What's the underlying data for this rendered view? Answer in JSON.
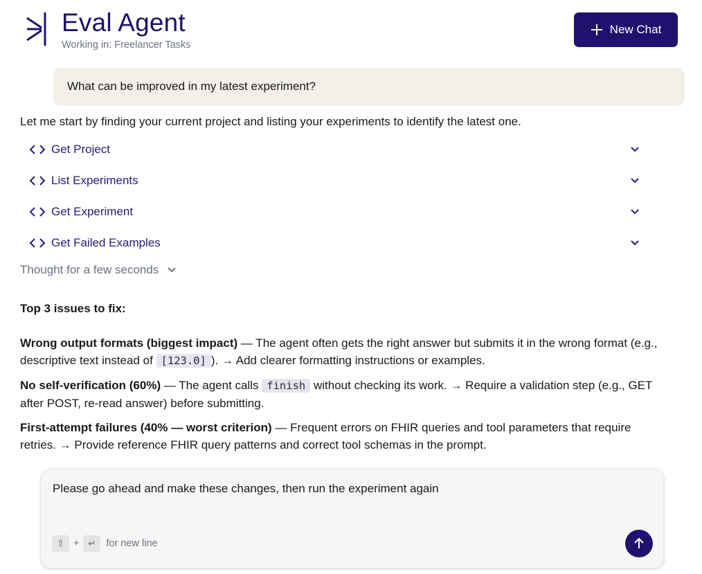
{
  "header": {
    "logo_icon": "asterisk-bar-logo",
    "title": "Eval Agent",
    "subtitle": "Working in: Freelancer Tasks",
    "new_chat_label": "New Chat",
    "accent_color": "#22106e"
  },
  "user_message": "What can be improved in my latest experiment?",
  "assistant": {
    "intro": "Let me start by finding your current project and listing your experiments to identify the latest one.",
    "tool_calls": [
      {
        "label": "Get Project"
      },
      {
        "label": "List Experiments"
      },
      {
        "label": "Get Experiment"
      },
      {
        "label": "Get Failed Examples"
      }
    ],
    "thought_label": "Thought for a few seconds",
    "issues_heading": "Top 3 issues to fix:",
    "issues": [
      {
        "title": "Wrong output formats (biggest impact)",
        "text_before_code": " — The agent often gets the right answer but submits it in the wrong format (e.g., descriptive text instead of ",
        "code": "[123.0]",
        "text_after_code": "). → Add clearer formatting instructions or examples."
      },
      {
        "title": "No self-verification (60%)",
        "text_before_code": " — The agent calls ",
        "code": "finish",
        "text_after_code": " without checking its work. → Require a validation step (e.g., GET after POST, re-read answer) before submitting."
      },
      {
        "title": "First-attempt failures (40% — worst criterion)",
        "text_before_code": " — Frequent errors on FHIR queries and tool parameters that require retries. → Provide reference FHIR query patterns and correct tool schemas in the prompt.",
        "code": "",
        "text_after_code": ""
      }
    ]
  },
  "composer": {
    "value": "Please go ahead and make these changes, then run the experiment again",
    "hint_plus": "+",
    "hint_text": "for new line",
    "shift_icon": "shift-key-icon",
    "enter_icon": "enter-key-icon",
    "send_icon": "arrow-up-icon"
  }
}
